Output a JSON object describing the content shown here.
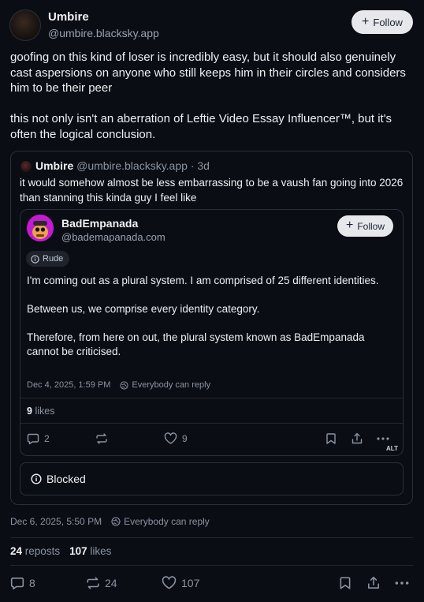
{
  "author": {
    "name": "Umbire",
    "handle": "@umbire.blacksky.app",
    "follow_label": "Follow"
  },
  "post": {
    "text": "goofing on this kind of loser is incredibly easy, but it should also genuinely cast aspersions on anyone who still keeps him in their circles and considers him to be their peer\n\nthis not only isn't an aberration of Leftie Video Essay Influencer™, but it's often the logical conclusion.",
    "date": "Dec 6, 2025, 5:50 PM",
    "reply_setting": "Everybody can reply",
    "reposts_count": "24",
    "reposts_label": "reposts",
    "likes_count": "107",
    "likes_label": "likes",
    "actions": {
      "replies": "8",
      "reposts": "24",
      "likes": "107"
    }
  },
  "quote": {
    "name": "Umbire",
    "handle": "@umbire.blacksky.app",
    "age": "· 3d",
    "text": "it would somehow almost be less embarrassing to be a vaush fan going into 2026 than stanning this kinda guy I feel like",
    "embedded": {
      "name": "BadEmpanada",
      "handle": "@bademapanada.com",
      "follow_label": "Follow",
      "label_badge": "Rude",
      "text": "I'm coming out as a plural system. I am comprised of 25 different identities.\n\nBetween us, we comprise every identity category.\n\nTherefore, from here on out, the plural system known as BadEmpanada cannot be criticised.",
      "date": "Dec 4, 2025, 1:59 PM",
      "reply_setting": "Everybody can reply",
      "likes_count": "9",
      "likes_label": "likes",
      "actions": {
        "replies": "2",
        "likes": "9"
      },
      "alt_badge": "ALT"
    },
    "blocked_label": "Blocked"
  }
}
